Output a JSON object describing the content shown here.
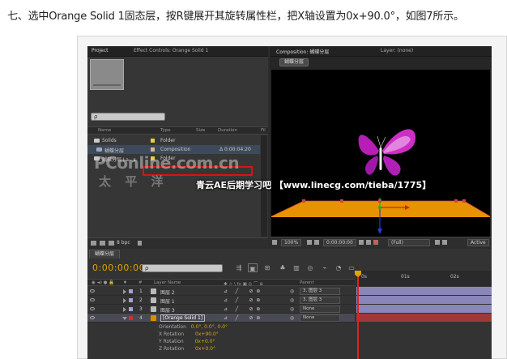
{
  "caption": "七、选中Orange Solid 1固态层，按R键展开其旋转属性栏，把X轴设置为0x+90.0°，如图7所示。",
  "project_panel": {
    "tab_project": "Project",
    "tab_effect_controls": "Effect Controls: Orange Solid 1",
    "search_placeholder": "ρ",
    "columns": {
      "name": "Name",
      "type": "Type",
      "size": "Size",
      "duration": "Duration",
      "file": "Fil"
    },
    "items": [
      {
        "name": "Solids",
        "type": "Folder",
        "duration": "",
        "swatch": "#e8d040"
      },
      {
        "name": "蝴蝶分层",
        "type": "Composition",
        "duration": "Δ 0:00:04:20",
        "swatch": "#d8b890"
      },
      {
        "name": "蝴蝶分层 La...s",
        "type": "Folder",
        "duration": "",
        "swatch": "#e8d040"
      }
    ],
    "bit_depth": "8 bpc"
  },
  "comp_panel": {
    "tab_composition": "Composition: 蝴蝶分层",
    "tab_layer": "Layer: (none)",
    "breadcrumb": "蝴蝶分层",
    "zoom": "100%",
    "timecode": "0:00:00:00",
    "resolution": "(Full)",
    "view": "Active",
    "plane_color": "#e79200",
    "butterfly_color": "#c020c0"
  },
  "timeline": {
    "tab": "蝴蝶分层",
    "timecode": "0:00:00:00",
    "search_placeholder": "ρ",
    "columns": {
      "layer_name": "Layer Name",
      "num": "#",
      "parent": "Parent"
    },
    "ruler_labels": [
      "0s",
      "01s",
      "02s"
    ],
    "layers": [
      {
        "num": "1",
        "name": "图层 2",
        "parent": "3. 图层 3",
        "color": "#a8a0d8",
        "bar": "#8a86b8"
      },
      {
        "num": "2",
        "name": "图层 1",
        "parent": "3. 图层 3",
        "color": "#a8a0d8",
        "bar": "#8a86b8"
      },
      {
        "num": "3",
        "name": "图层 3",
        "parent": "None",
        "color": "#a8a0d8",
        "bar": "#8a86b8"
      },
      {
        "num": "4",
        "name": "[Orange Solid 1]",
        "parent": "None",
        "color": "#d03030",
        "bar": "#a03838"
      }
    ],
    "properties": [
      {
        "name": "Orientation",
        "value": "0.0°, 0.0°, 0.0°"
      },
      {
        "name": "X Rotation",
        "value": "0x+90.0°"
      },
      {
        "name": "Y Rotation",
        "value": "0x+0.0°"
      },
      {
        "name": "Z Rotation",
        "value": "0x+0.0°"
      }
    ],
    "highlight_color": "#e01010"
  },
  "watermarks": {
    "pconline": "PConline.com.cn",
    "taipingyang": "太 平 洋",
    "credit": "青云AE后期学习吧 【www.linecg.com/tieba/1775】"
  }
}
